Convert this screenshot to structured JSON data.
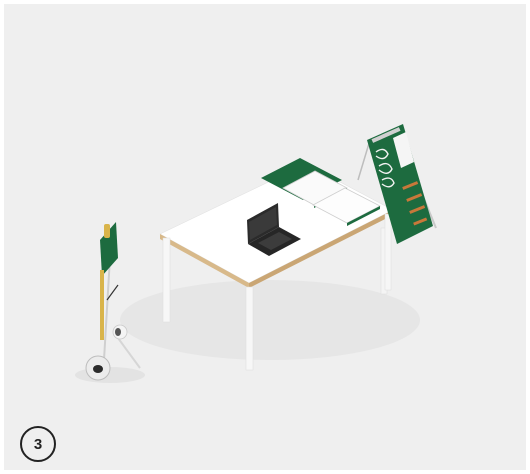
{
  "step": {
    "number": "3"
  },
  "colors": {
    "background": "#efefef",
    "panel_green": "#1d6b3f",
    "table_top": "#ffffff",
    "table_edge_wood": "#d8b98a",
    "laptop": "#2a2a2a",
    "leg": "#f7f7f7",
    "accent_yellow": "#d9b44a",
    "accent_orange": "#c8783a"
  },
  "scene": {
    "objects": [
      "table",
      "laptop",
      "green-folder",
      "white-binders",
      "green-easel-board",
      "hand-truck"
    ]
  }
}
